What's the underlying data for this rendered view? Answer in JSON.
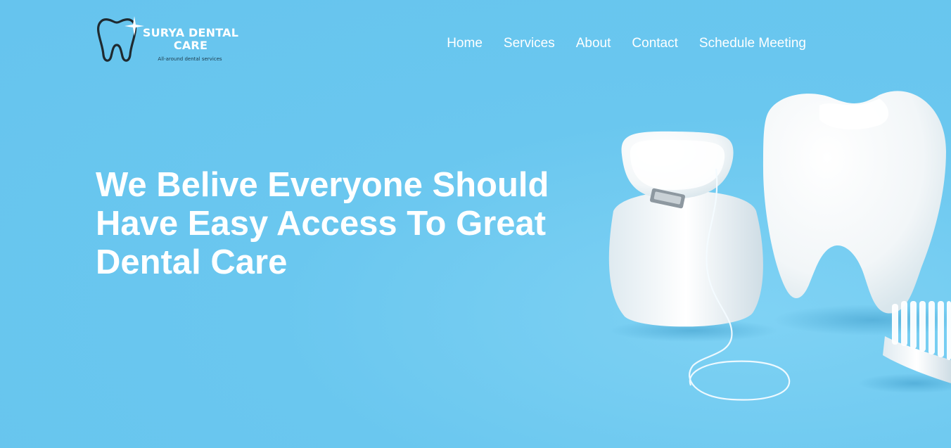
{
  "brand": {
    "name_line1": "SURYA DENTAL",
    "name_line2": "CARE",
    "tagline": "All-around dental services"
  },
  "nav": {
    "items": [
      {
        "label": "Home"
      },
      {
        "label": "Services"
      },
      {
        "label": "About"
      },
      {
        "label": "Contact"
      },
      {
        "label": "Schedule Meeting"
      }
    ]
  },
  "hero": {
    "headline": "We Belive Everyone Should Have Easy Access To Great Dental Care"
  },
  "icons": [
    "tooth-logo-icon",
    "sparkle-icon"
  ],
  "colors": {
    "background": "#6cc8ef",
    "text": "#ffffff",
    "logo_outline": "#1f2a30"
  }
}
